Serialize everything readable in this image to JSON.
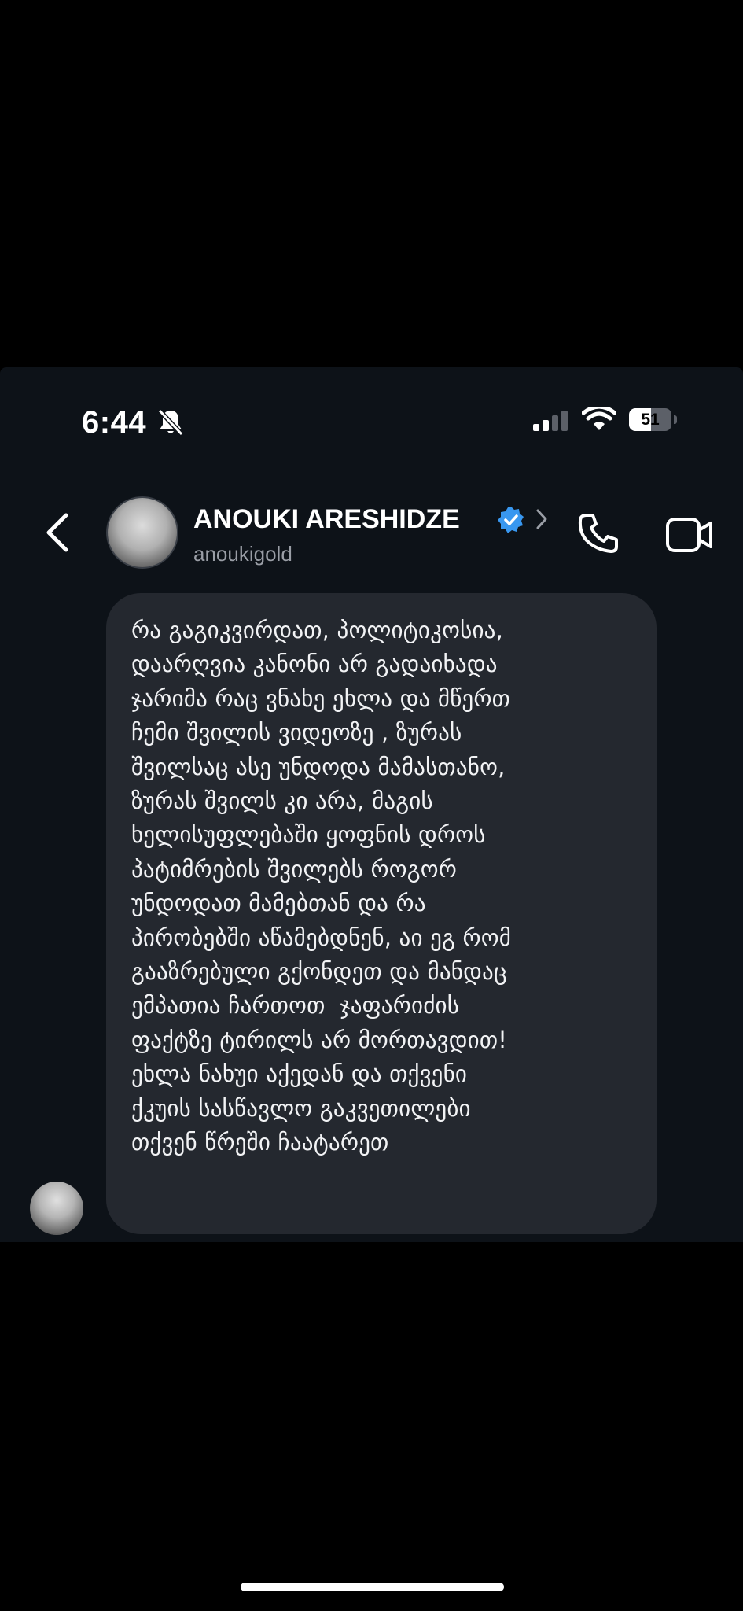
{
  "status_bar": {
    "time": "6:44",
    "battery_level": "51",
    "battery_fraction": 0.51
  },
  "header": {
    "contact_name": "ANOUKI ARESHIDZE",
    "username": "anoukigold",
    "verified": true
  },
  "icons": {
    "muted": "bell-slash-icon",
    "signal": "cellular-signal-icon",
    "wifi": "wifi-icon",
    "back": "chevron-left-icon",
    "verified": "verified-badge-icon",
    "profile_link": "chevron-right-icon",
    "call": "phone-icon",
    "video": "video-camera-icon"
  },
  "colors": {
    "screen_background": "#0d1218",
    "bubble_background": "#24282f",
    "verified_blue": "#3897f0",
    "username_gray": "#9a9ea6"
  },
  "message": {
    "lines": [
      "რა გაგიკვირდათ, პოლიტიკოსია,",
      "დაარღვია კანონი არ გადაიხადა",
      "ჯარიმა რაც ვნახე ეხლა და მწერთ",
      "ჩემი შვილის ვიდეოზე , ზურას",
      "შვილსაც ასე უნდოდა მამასთანო,",
      "ზურას შვილს კი არა, მაგის",
      "ხელისუფლებაში ყოფნის დროს",
      "პატიმრების შვილებს როგორ",
      "უნდოდათ მამებთან და რა",
      "პირობებში აწამებდნენ, აი ეგ რომ",
      "გააზრებული გქონდეთ და მანდაც",
      "ემპათია ჩართოთ  ჯაფარიძის",
      "ფაქტზე ტირილს არ მორთავდით!",
      "ეხლა ნახუი აქედან და თქვენი",
      "ქკუის სასწავლო გაკვეთილები",
      "თქვენ წრეში ჩაატარეთ"
    ]
  }
}
